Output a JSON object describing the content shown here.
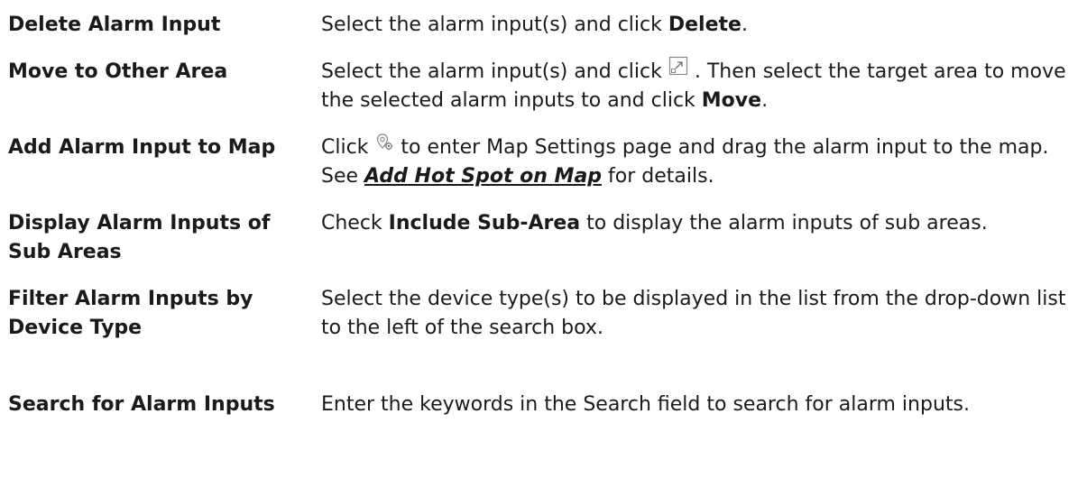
{
  "rows": [
    {
      "term": "Delete Alarm Input",
      "desc": {
        "t1": "Select the alarm input(s) and click ",
        "b1": "Delete",
        "t2": "."
      }
    },
    {
      "term": "Move to Other Area",
      "desc": {
        "t1": "Select the alarm input(s) and click ",
        "icon": "move-to-area-icon",
        "t2": " . Then select the target area to move the selected alarm inputs to and click ",
        "b1": "Move",
        "t3": "."
      }
    },
    {
      "term": "Add Alarm Input to Map",
      "desc": {
        "t1": "Click ",
        "icon": "map-settings-icon",
        "t2": " to enter Map Settings page and drag the alarm input to the map. See ",
        "link": "Add Hot Spot on Map",
        "t3": " for details."
      }
    },
    {
      "term": "Display Alarm Inputs of Sub Areas",
      "desc": {
        "t1": "Check ",
        "b1": "Include Sub-Area",
        "t2": " to display the alarm inputs of sub areas."
      }
    },
    {
      "term": "Filter Alarm Inputs by Device Type",
      "desc": {
        "t1": "Select the device type(s) to be displayed in the list from the drop-down list to the left of the search box."
      }
    },
    {
      "term": "Search for Alarm Inputs",
      "desc": {
        "t1": "Enter the keywords in the Search field to search for alarm inputs."
      }
    }
  ]
}
